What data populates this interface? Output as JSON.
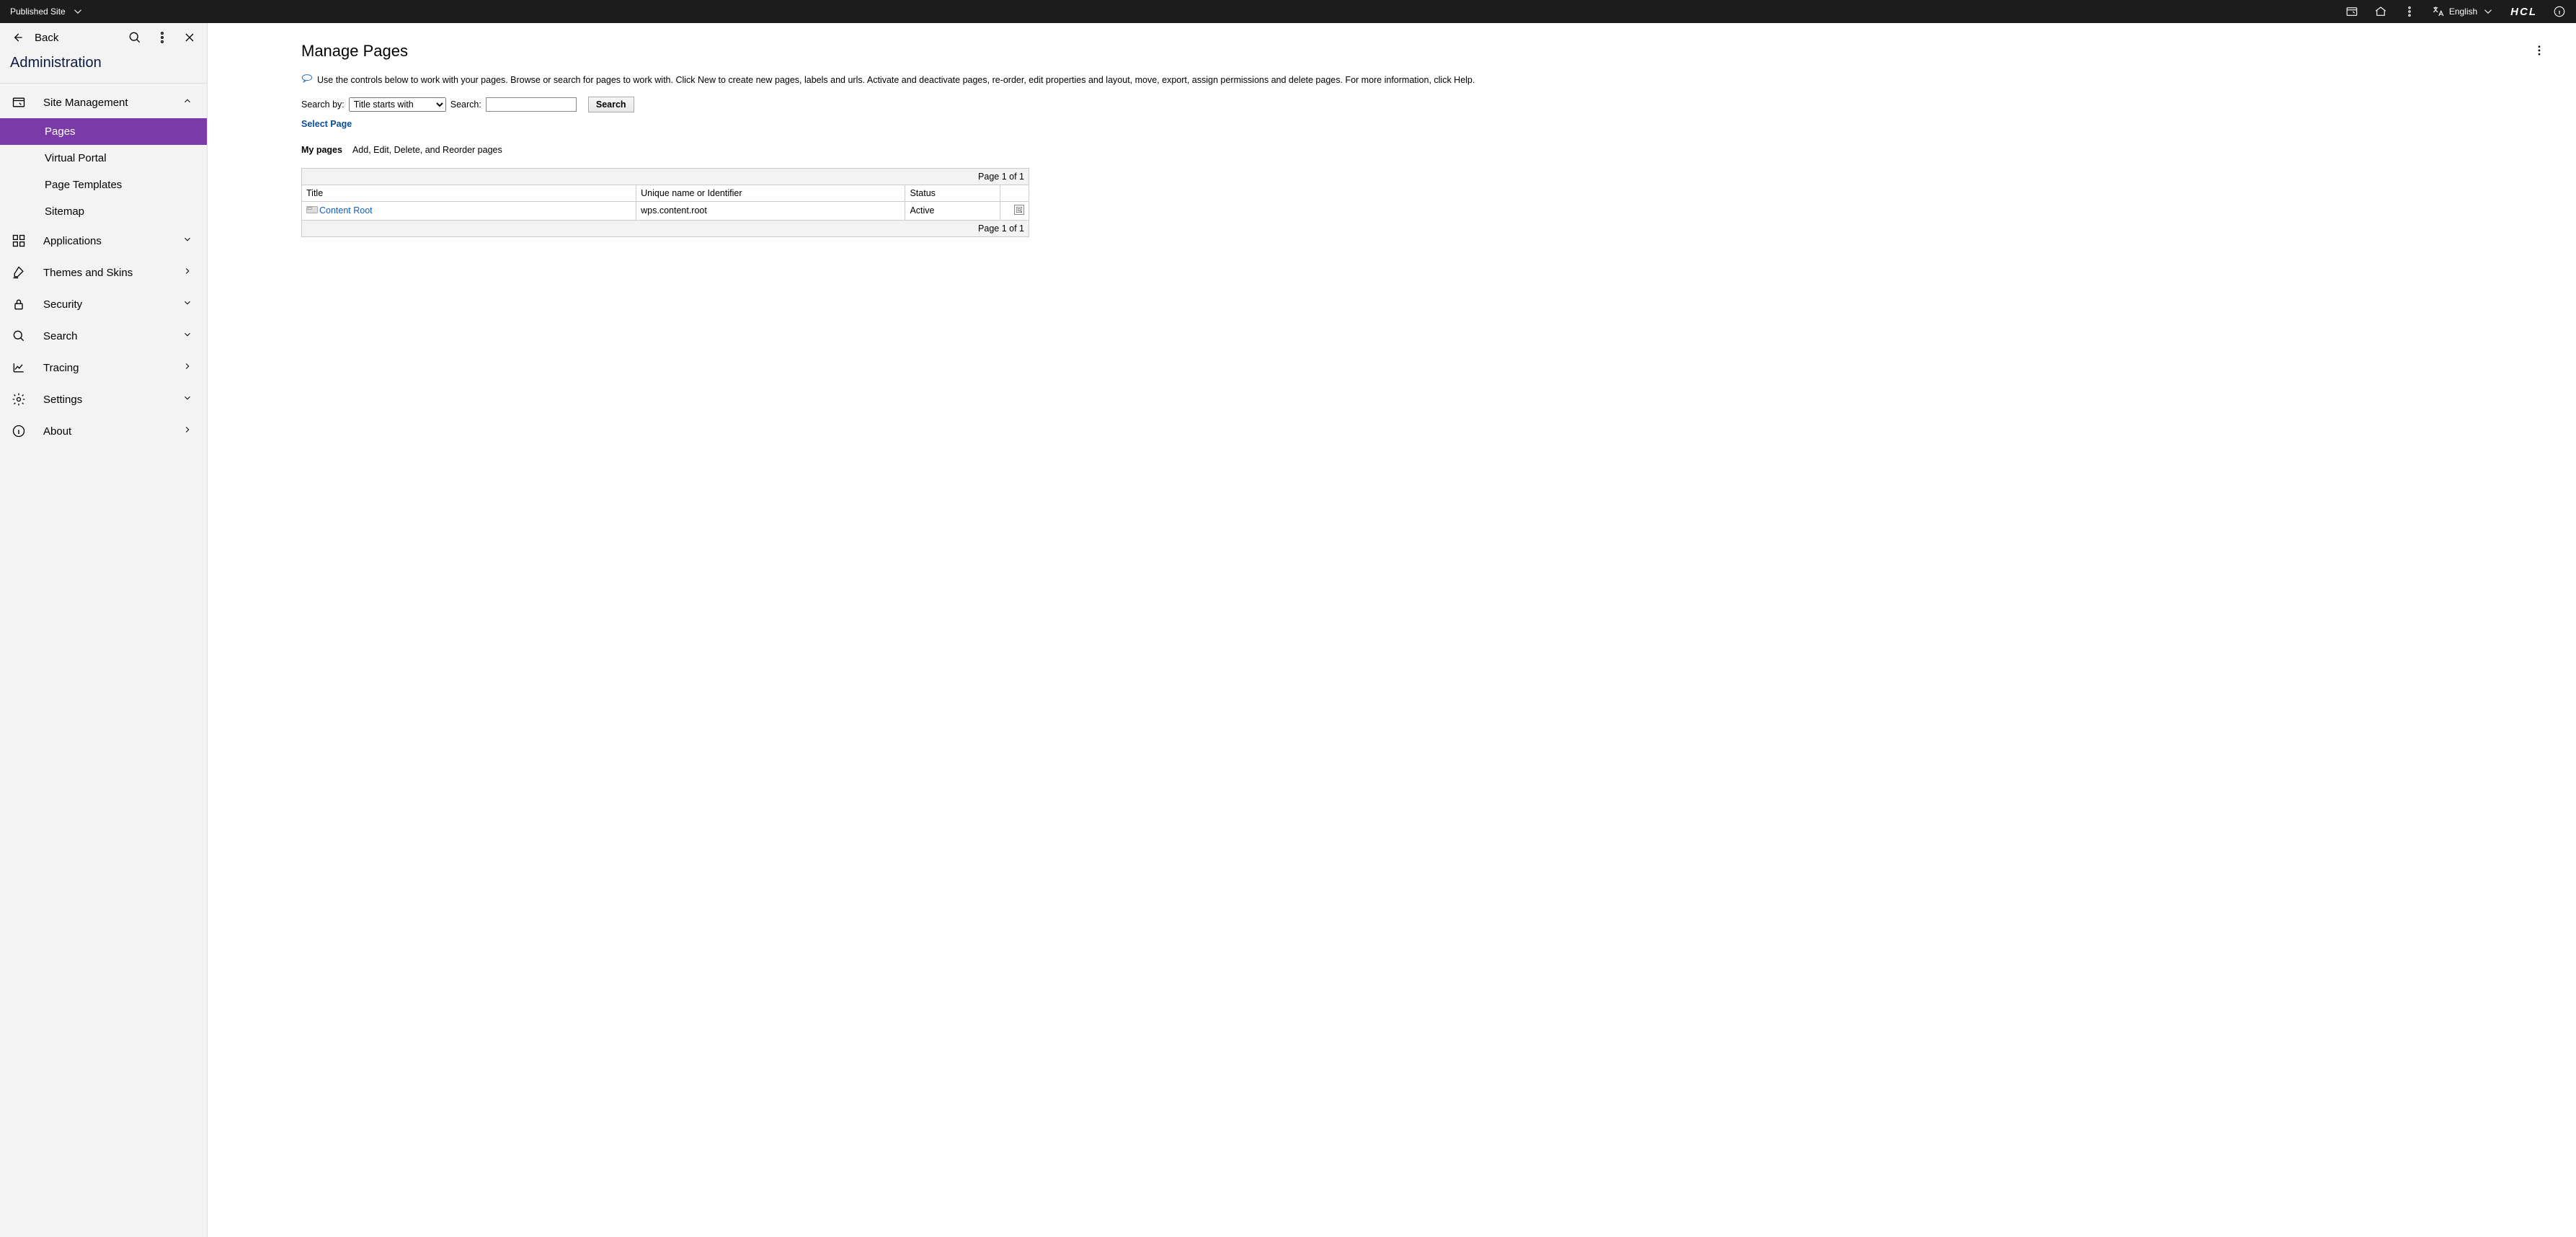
{
  "topbar": {
    "siteLabel": "Published Site",
    "language": "English",
    "brand": "HCL"
  },
  "sidebar": {
    "backLabel": "Back",
    "heading": "Administration",
    "items": [
      {
        "label": "Site Management",
        "expanded": true,
        "type": "group",
        "children": [
          {
            "label": "Pages",
            "active": true
          },
          {
            "label": "Virtual Portal"
          },
          {
            "label": "Page Templates"
          },
          {
            "label": "Sitemap"
          }
        ]
      },
      {
        "label": "Applications",
        "chev": "down"
      },
      {
        "label": "Themes and Skins",
        "chev": "right"
      },
      {
        "label": "Security",
        "chev": "down"
      },
      {
        "label": "Search",
        "chev": "down"
      },
      {
        "label": "Tracing",
        "chev": "right"
      },
      {
        "label": "Settings",
        "chev": "down"
      },
      {
        "label": "About",
        "chev": "right"
      }
    ]
  },
  "main": {
    "title": "Manage Pages",
    "infoText": "Use the controls below to work with your pages. Browse or search for pages to work with. Click New to create new pages, labels and urls. Activate and deactivate pages, re-order, edit properties and layout, move, export, assign permissions and delete pages. For more information, click Help.",
    "searchByLabel": "Search by:",
    "searchByOptions": [
      "Title starts with"
    ],
    "searchBySelected": "Title starts with",
    "searchLabel": "Search:",
    "searchValue": "",
    "searchButton": "Search",
    "selectPageLink": "Select Page",
    "myPagesLabel": "My pages",
    "myPagesDesc": "Add, Edit, Delete, and Reorder pages",
    "pagerText": "Page 1 of 1",
    "columns": {
      "title": "Title",
      "uname": "Unique name or Identifier",
      "status": "Status"
    },
    "rows": [
      {
        "title": "Content Root",
        "uname": "wps.content.root",
        "status": "Active"
      }
    ]
  }
}
